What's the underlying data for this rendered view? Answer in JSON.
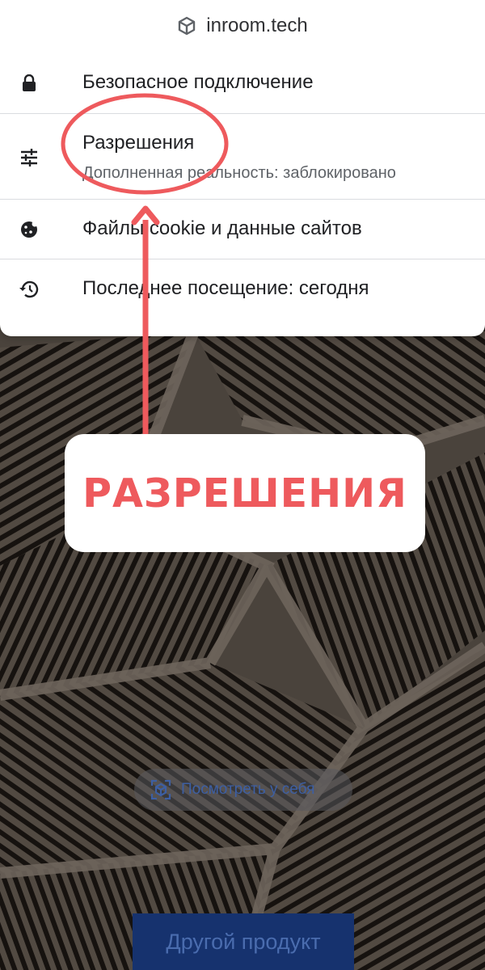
{
  "site": {
    "name": "inroom.tech",
    "icon": "cube-icon"
  },
  "menu": {
    "secure": {
      "label": "Безопасное подключение",
      "icon": "lock-icon"
    },
    "permissions": {
      "label": "Разрешения",
      "detail": "Дополненная реальность: заблокировано",
      "icon": "tune-icon"
    },
    "cookies": {
      "label": "Файлы cookie и данные сайтов",
      "icon": "cookie-icon"
    },
    "last_visit": {
      "label": "Последнее посещение: сегодня",
      "icon": "history-icon"
    }
  },
  "annotation": {
    "label": "РАЗРЕШЕНИЯ",
    "color": "#ee5a5d"
  },
  "ar_chip": {
    "label": "Посмотреть у себя",
    "icon": "ar-cube-icon"
  },
  "product_button": {
    "label": "Другой продукт"
  }
}
